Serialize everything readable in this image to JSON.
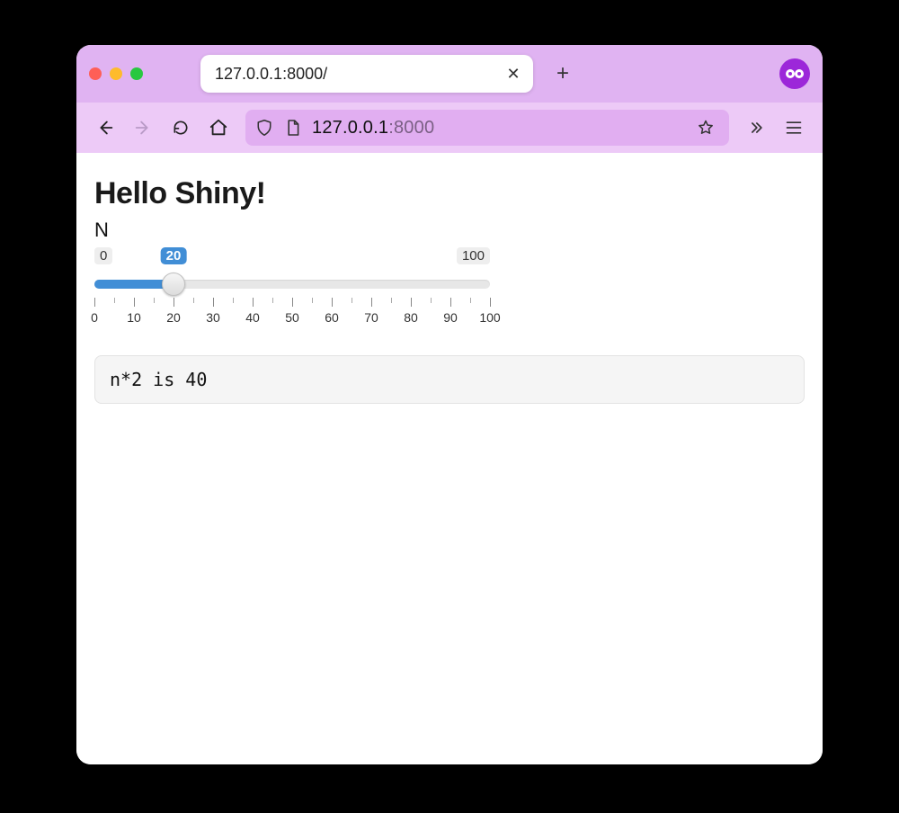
{
  "browser": {
    "tab_title": "127.0.0.1:8000/",
    "url_main": "127.0.0.1",
    "url_port": ":8000",
    "profile_color": "#9c27d9"
  },
  "page": {
    "title": "Hello Shiny!",
    "slider": {
      "label": "N",
      "min": 0,
      "max": 100,
      "value": 20,
      "min_label": "0",
      "max_label": "100",
      "value_label": "20",
      "ticks": [
        0,
        10,
        20,
        30,
        40,
        50,
        60,
        70,
        80,
        90,
        100
      ]
    },
    "output": "n*2 is 40"
  }
}
